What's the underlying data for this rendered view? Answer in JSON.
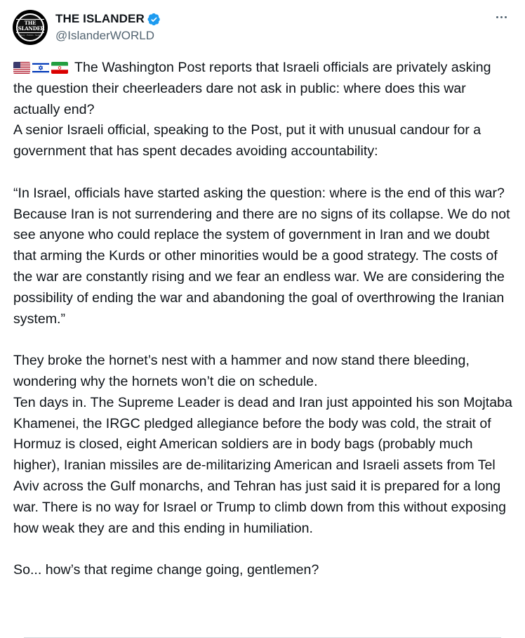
{
  "post": {
    "author": {
      "display_name": "THE ISLANDER",
      "handle": "@IslanderWORLD",
      "verified": true,
      "avatar_text": "THE ISLANDER",
      "avatar_subtext": "History · Politics · Society"
    },
    "flags": [
      "us-flag-icon",
      "israel-flag-icon",
      "iran-flag-icon"
    ],
    "paragraphs": [
      "The Washington Post reports that Israeli officials are privately asking the question their cheerleaders dare not ask in public: where does this war actually end?",
      "A senior Israeli official, speaking to the Post, put it with unusual candour for a government that has spent decades avoiding accountability:",
      "“In Israel, officials have started asking the question: where is the end of this war? Because Iran is not surrendering and there are no signs of its collapse. We do not see anyone who could replace the system of government in Iran and we doubt that arming the Kurds or other minorities would be a good strategy. The costs of the war are constantly rising and we fear an endless war. We are considering the possibility of ending the war and abandoning the goal of overthrowing the Iranian system.”",
      "They broke the hornet’s nest with a hammer and now stand there bleeding, wondering why the hornets won’t die on schedule.",
      "Ten days in. The Supreme Leader is dead and Iran just appointed his son Mojtaba Khamenei, the IRGC pledged allegiance before the body was cold, the strait of Hormuz is closed, eight American soldiers are in body bags (probably much higher), Iranian missiles are de-militarizing American and Israeli assets from Tel Aviv across the Gulf monarchs, and Tehran has just said it is prepared for a long war. There is no way for Israel or Trump to climb down from this without exposing how weak they are and this ending in humiliation.",
      "So... how’s that regime change going, gentlemen?"
    ]
  },
  "colors": {
    "text": "#0f1419",
    "secondary": "#536471",
    "verified_badge": "#1d9bf0",
    "divider": "#cfd9de"
  }
}
